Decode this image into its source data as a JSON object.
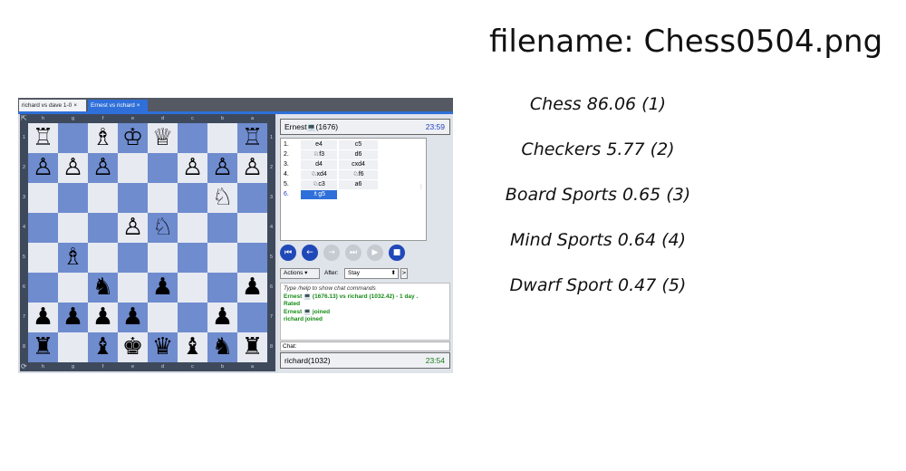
{
  "filename_label": "filename: Chess0504.png",
  "predictions": [
    "Chess 86.06 (1)",
    "Checkers  5.77 (2)",
    "Board Sports  0.65 (3)",
    "Mind Sports  0.64 (4)",
    "Dwarf Sport  0.47 (5)"
  ],
  "tabs": [
    {
      "label": "richard vs dave 1-0",
      "close": "×"
    },
    {
      "label": "Ernest vs richard",
      "close": "×"
    }
  ],
  "board": {
    "files": [
      "h",
      "g",
      "f",
      "e",
      "d",
      "c",
      "b",
      "a"
    ],
    "ranks": [
      "1",
      "2",
      "3",
      "4",
      "5",
      "6",
      "7",
      "8"
    ],
    "corner_top": "⇱",
    "corner_bottom": "⟳",
    "rows": [
      [
        "♖",
        "",
        "♗",
        "♔",
        "♕",
        "",
        "",
        "♖"
      ],
      [
        "♙",
        "♙",
        "♙",
        "",
        "",
        "♙",
        "♙",
        "♙"
      ],
      [
        "",
        "",
        "",
        "",
        "",
        "",
        "♘",
        ""
      ],
      [
        "",
        "",
        "",
        "♙",
        "♘",
        "",
        "",
        ""
      ],
      [
        "",
        "♗",
        "",
        "",
        "",
        "",
        "",
        ""
      ],
      [
        "",
        "",
        "♞",
        "",
        "♟",
        "",
        "",
        "♟"
      ],
      [
        "♟",
        "♟",
        "♟",
        "♟",
        "",
        "",
        "♟",
        ""
      ],
      [
        "♜",
        "",
        "♝",
        "♚",
        "♛",
        "♝",
        "♞",
        "♜"
      ]
    ]
  },
  "top_player": {
    "name": "Ernest",
    "rating": "(1676)",
    "time": "23:59",
    "icon": "computer-icon"
  },
  "bottom_player": {
    "name": "richard(1032)",
    "time": "23:54"
  },
  "moves": [
    {
      "num": "1.",
      "white": "e4",
      "black": "c5"
    },
    {
      "num": "2.",
      "white": "♘f3",
      "black": "d6"
    },
    {
      "num": "3.",
      "white": "d4",
      "black": "cxd4"
    },
    {
      "num": "4.",
      "white": "♘xd4",
      "black": "♘f6"
    },
    {
      "num": "5.",
      "white": "♘c3",
      "black": "a6"
    },
    {
      "num": "6.",
      "white": "♗g5",
      "black": ""
    }
  ],
  "controls": {
    "first": "⏮",
    "back": "←",
    "forward": "→",
    "last": "⏭",
    "play": "▶",
    "stop": "■"
  },
  "actions_label": "Actions ▾",
  "after_label": "After:",
  "after_value": "Stay",
  "after_arrow": "⬍",
  "after_go": ">",
  "chat_log": {
    "hint": "Type /help to show chat commands",
    "line1": "Ernest 💻 (1676.13) vs richard (1032.42) - 1 day .",
    "line2": "Rated",
    "line3": "Ernest 💻 joined",
    "line4": "richard joined"
  },
  "chat_label": "Chat:",
  "colors": {
    "accent": "#2f6fd9",
    "light_square": "#e7eaf1",
    "dark_square": "#6f8ccf",
    "joined_green": "#148a14"
  }
}
